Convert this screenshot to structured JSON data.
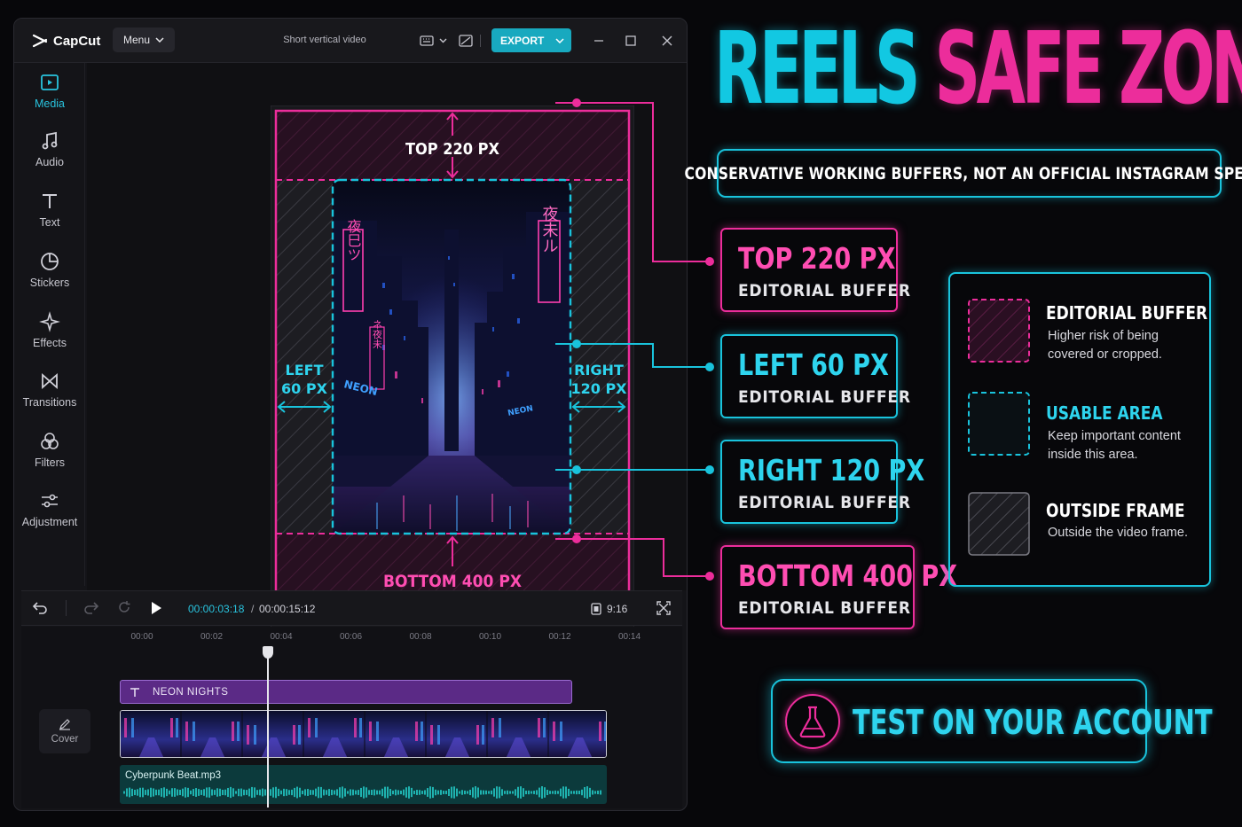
{
  "app": {
    "name": "CapCut",
    "menu_label": "Menu",
    "project_title": "Short vertical video",
    "export_label": "EXPORT"
  },
  "sidebar": {
    "items": [
      {
        "label": "Media",
        "icon": "media-icon",
        "active": true
      },
      {
        "label": "Audio",
        "icon": "music-note-icon"
      },
      {
        "label": "Text",
        "icon": "text-icon"
      },
      {
        "label": "Stickers",
        "icon": "sticker-icon"
      },
      {
        "label": "Effects",
        "icon": "sparkle-icon"
      },
      {
        "label": "Transitions",
        "icon": "transition-icon"
      },
      {
        "label": "Filters",
        "icon": "filters-icon"
      },
      {
        "label": "Adjustment",
        "icon": "sliders-icon"
      }
    ]
  },
  "preview": {
    "zones": {
      "top": "TOP 220 PX",
      "bottom": "BOTTOM 400 PX",
      "left_line1": "LEFT",
      "left_line2": "60 PX",
      "right_line1": "RIGHT",
      "right_line2": "120 PX"
    },
    "signs": {
      "left_vertical": "夜巳ツ",
      "right_vertical": "夜未ル",
      "left_small": "ネ夜未",
      "neon_left": "NEON",
      "neon_right": "NEON"
    }
  },
  "transport": {
    "current_time": "00:00:03:18",
    "separator": "/",
    "total_time": "00:00:15:12",
    "aspect_ratio": "9:16"
  },
  "timeline": {
    "ruler": [
      "00:00",
      "00:02",
      "00:04",
      "00:06",
      "00:08",
      "00:10",
      "00:12",
      "00:14"
    ],
    "playhead_seconds": 3.6,
    "cover_label": "Cover",
    "text_clip": "NEON NIGHTS",
    "audio_clip": "Cyberpunk Beat.mp3"
  },
  "headline": {
    "word1": "REELS",
    "word2": "SAFE ZONE"
  },
  "subtitle": "CONSERVATIVE WORKING BUFFERS, NOT AN OFFICIAL INSTAGRAM SPEC",
  "callouts": [
    {
      "title": "TOP 220 PX",
      "sub": "EDITORIAL BUFFER",
      "color": "pink"
    },
    {
      "title": "LEFT 60 PX",
      "sub": "EDITORIAL BUFFER",
      "color": "cyan"
    },
    {
      "title": "RIGHT 120 PX",
      "sub": "EDITORIAL BUFFER",
      "color": "cyan"
    },
    {
      "title": "BOTTOM 400 PX",
      "sub": "EDITORIAL BUFFER",
      "color": "pink"
    }
  ],
  "legend": [
    {
      "title": "EDITORIAL BUFFER",
      "desc": "Higher risk of being covered or cropped.",
      "color": "#ec2d9b"
    },
    {
      "title": "USABLE AREA",
      "desc": "Keep important content inside this area.",
      "color": "#19c3dc"
    },
    {
      "title": "OUTSIDE FRAME",
      "desc": "Outside the video frame.",
      "color": "#9a9aa2"
    }
  ],
  "cta": {
    "label": "TEST ON YOUR ACCOUNT",
    "icon": "flask-icon"
  },
  "colors": {
    "pink": "#ec2d9b",
    "cyan": "#19c3dc",
    "accent_button": "#18a9bf"
  }
}
